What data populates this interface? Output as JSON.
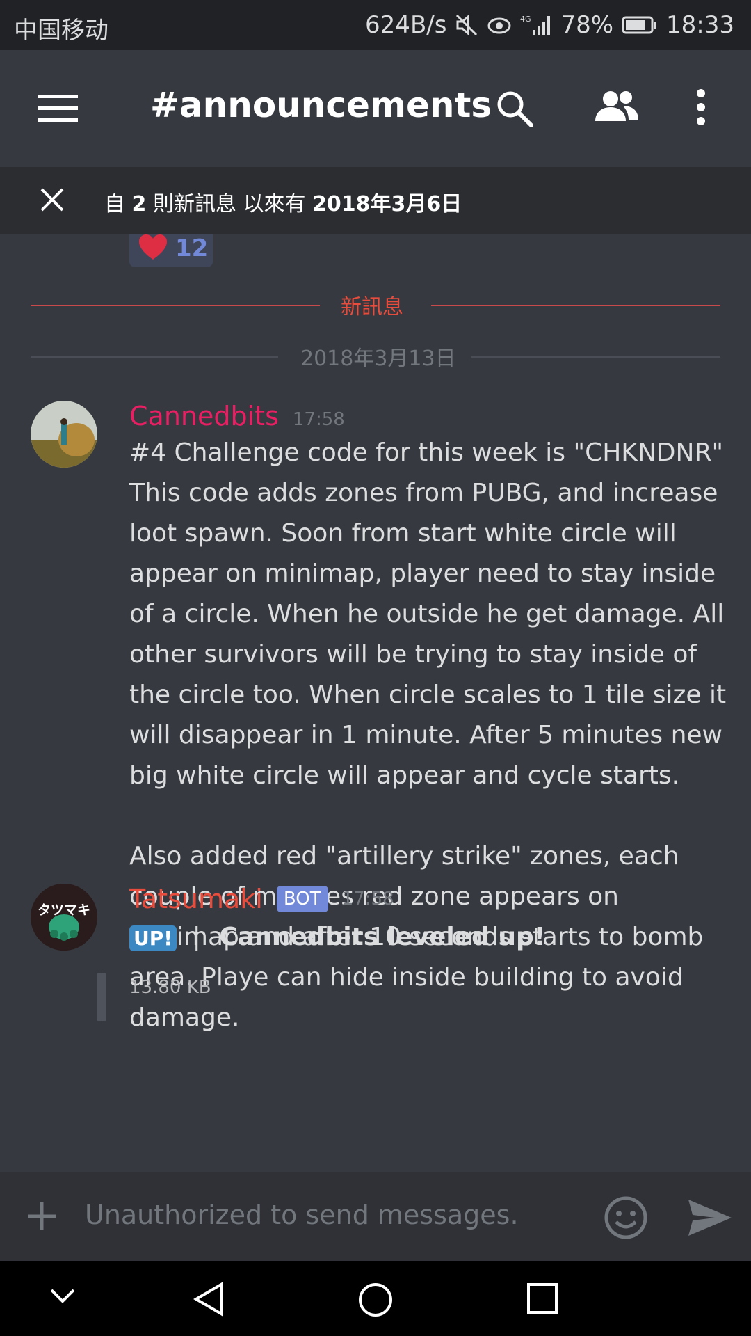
{
  "status_bar": {
    "carrier": "中国移动",
    "net_speed": "624B/s",
    "network": "4G",
    "battery": "78%",
    "time": "18:33"
  },
  "header": {
    "channel": "#announcements",
    "icons": [
      "menu-icon",
      "search-icon",
      "members-icon",
      "more-icon"
    ]
  },
  "banner": {
    "prefix": "自",
    "count": "2",
    "middle": "則新訊息 以來有",
    "date": "2018年3月6日"
  },
  "reaction": {
    "emoji": "heart",
    "count": "12"
  },
  "new_messages_label": "新訊息",
  "date_separator": "2018年3月13日",
  "messages": [
    {
      "author": "Cannedbits",
      "author_color": "#e91e63",
      "time": "17:58",
      "text": "#4 Challenge code for this week is \"CHKNDNR\" This code adds zones from PUBG, and increase loot spawn. Soon from start white circle will appear on minimap, player need to stay inside of a circle. When he outside he get damage. All other survivors will be trying to stay inside of the circle too. When circle scales to 1 tile size it will disappear in 1 minute. After 5 minutes new big white circle will appear and cycle starts.\n\nAlso added red \"artillery strike\" zones, each couple of minutes red zone appears on minimap and after 10 seconds starts to bomb area. Playe can hide inside building to avoid damage."
    },
    {
      "author": "Tatsumaki",
      "author_color": "#e74c3c",
      "badge": "BOT",
      "time": "17:58",
      "avatar_text": "タツマキ",
      "up_label": "UP!",
      "separator": "|",
      "text": "Cannedbits leveled up!",
      "attachment_size": "13.80 KB"
    }
  ],
  "input": {
    "placeholder": "Unauthorized to send messages."
  },
  "colors": {
    "background": "#36393f",
    "accent": "#7289da",
    "new_marker": "#e74c3c"
  }
}
